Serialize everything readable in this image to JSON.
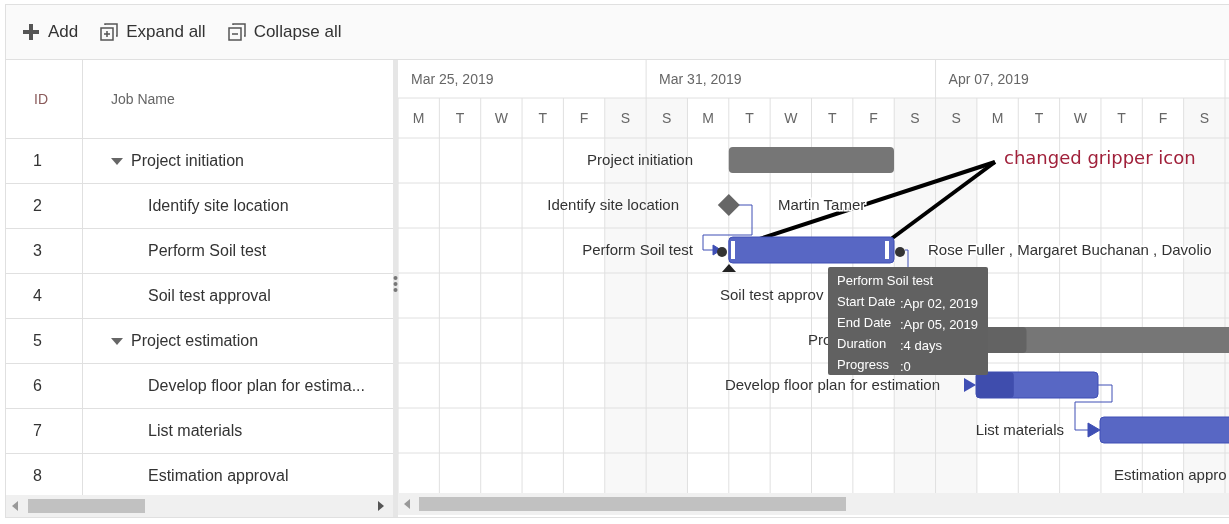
{
  "toolbar": [
    {
      "kind": "add",
      "label": "Add"
    },
    {
      "kind": "expand",
      "label": "Expand all"
    },
    {
      "kind": "collapse",
      "label": "Collapse all"
    }
  ],
  "grid": {
    "columns": [
      "ID",
      "Job Name"
    ],
    "rows": [
      {
        "id": "1",
        "name": "Project initiation",
        "expanded": true,
        "children": [
          {
            "id": "2",
            "name": "Identify site location"
          },
          {
            "id": "3",
            "name": "Perform Soil test"
          },
          {
            "id": "4",
            "name": "Soil test approval"
          }
        ]
      },
      {
        "id": "5",
        "name": "Project estimation",
        "expanded": true,
        "children": [
          {
            "id": "6",
            "name": "Develop floor plan for estima..."
          },
          {
            "id": "7",
            "name": "List materials"
          },
          {
            "id": "8",
            "name": "Estimation approval"
          }
        ]
      }
    ]
  },
  "timeline": {
    "weeks": [
      "Mar 25, 2019",
      "Mar 31, 2019",
      "Apr 07, 2019"
    ],
    "days": [
      "M",
      "T",
      "W",
      "T",
      "F",
      "S",
      "S",
      "M",
      "T",
      "W",
      "T",
      "F",
      "S",
      "S",
      "M",
      "T",
      "W",
      "T",
      "F",
      "S"
    ]
  },
  "chart": {
    "tasks": [
      {
        "kind": "summary",
        "label": "Project initiation"
      },
      {
        "kind": "milestone",
        "label": "Identify site location",
        "resource": "Martin Tamer"
      },
      {
        "kind": "task",
        "label": "Perform Soil test",
        "resource": "Rose Fuller , Margaret Buchanan , Davolio"
      },
      {
        "kind": "hidden",
        "label": "Soil test approv"
      },
      {
        "kind": "summary",
        "label": "Pro",
        "level": 0.49
      },
      {
        "kind": "task",
        "label": "Develop floor plan for estimation",
        "level": 0.31
      },
      {
        "kind": "task",
        "label": "List materials"
      },
      {
        "kind": "hidden",
        "label": "Estimation appro"
      }
    ],
    "tooltip": {
      "title": "Perform Soil test",
      "rows": [
        {
          "label": "Start Date",
          "value": ":Apr 02, 2019"
        },
        {
          "label": "End Date",
          "value": ":Apr 05, 2019"
        },
        {
          "label": "Duration",
          "value": ":4 days"
        },
        {
          "label": "Progress",
          "value": ":0"
        }
      ]
    },
    "annotation": "changed gripper icon"
  }
}
